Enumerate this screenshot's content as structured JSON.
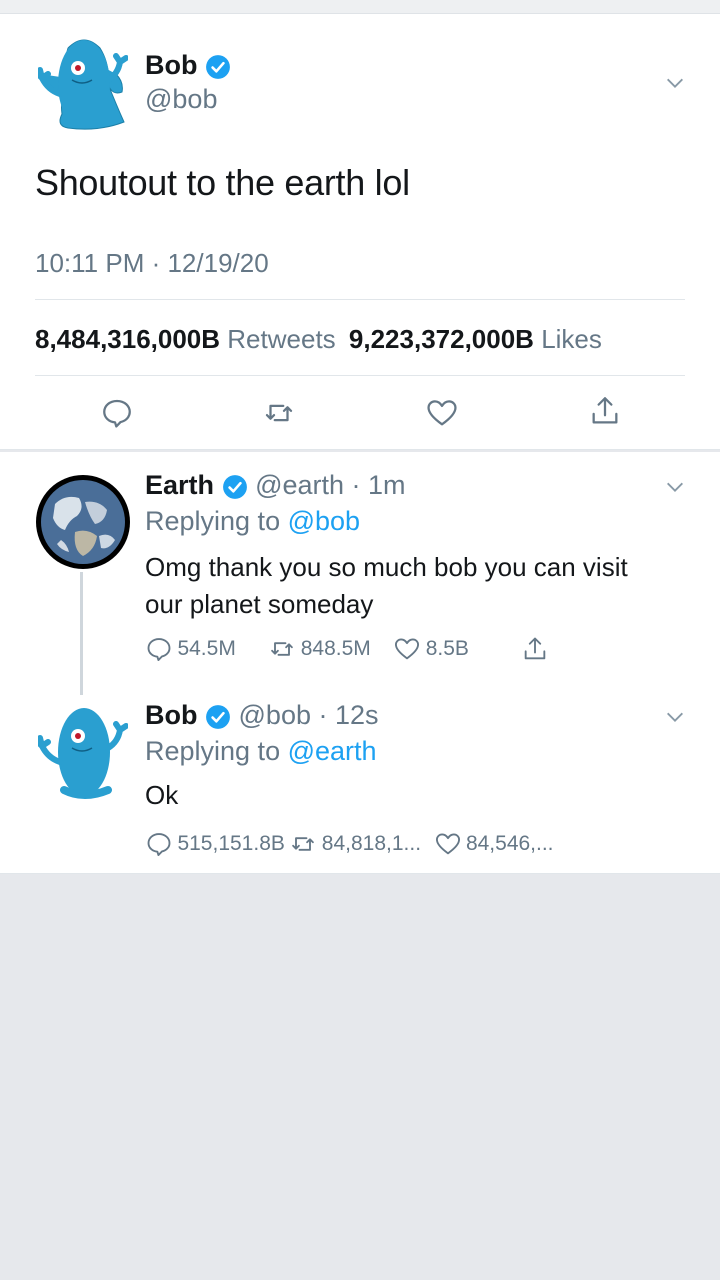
{
  "main_tweet": {
    "author_name": "Bob",
    "author_handle": "@bob",
    "text": "Shoutout to the earth lol",
    "timestamp": "10:11 PM · 12/19/20",
    "retweets_count": "8,484,316,000B",
    "retweets_label": "Retweets",
    "likes_count": "9,223,372,000B",
    "likes_label": "Likes"
  },
  "replies": [
    {
      "author_name": "Earth",
      "author_handle": "@earth",
      "time": "· 1m",
      "replying_prefix": "Replying to",
      "replying_to": "@bob",
      "text_line1": "Omg thank you so much bob you can visit",
      "text_line2": "our planet someday",
      "reply_count": "54.5M",
      "retweet_count": "848.5M",
      "like_count": "8.5B"
    },
    {
      "author_name": "Bob",
      "author_handle": "@bob",
      "time": "· 12s",
      "replying_prefix": "Replying to",
      "replying_to": "@earth",
      "text_line1": "Ok",
      "reply_count": "515,151.8B",
      "retweet_count": "84,818,1...",
      "like_count": "84,546,..."
    }
  ],
  "colors": {
    "accent": "#1da1f2",
    "muted": "#657786",
    "text": "#14171a",
    "background": "#e6e8ec",
    "avatar_blob": "#2a9fd0"
  },
  "icons": [
    "verified-badge-icon",
    "chevron-down-icon",
    "reply-icon",
    "retweet-icon",
    "like-icon",
    "share-icon"
  ]
}
